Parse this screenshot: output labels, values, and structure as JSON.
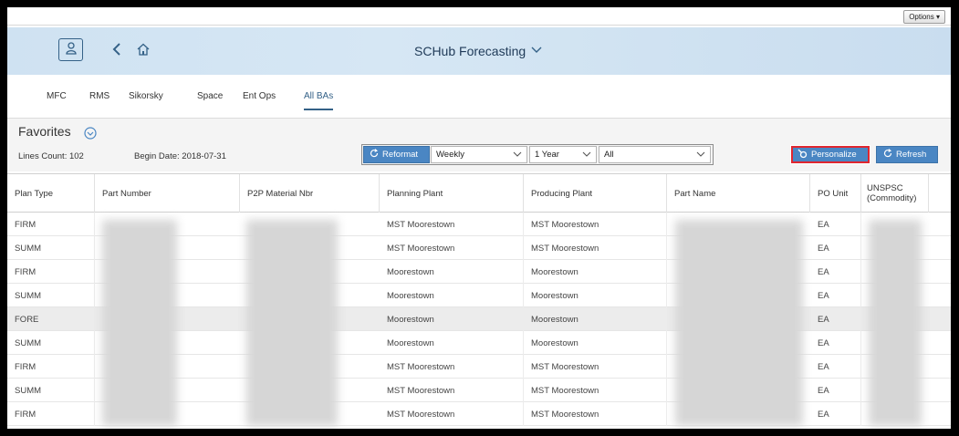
{
  "options": {
    "label": "Options ▾"
  },
  "shell": {
    "title": "SCHub Forecasting",
    "icons": {
      "user": "user-icon",
      "back": "back-chevron-icon",
      "home": "home-icon",
      "title_menu": "chevron-down-icon"
    }
  },
  "tabs": [
    {
      "label": "MFC",
      "active": false
    },
    {
      "label": "RMS",
      "active": false
    },
    {
      "label": "Sikorsky",
      "active": false
    },
    {
      "label": "Space",
      "active": false
    },
    {
      "label": "Ent Ops",
      "active": false
    },
    {
      "label": "All BAs",
      "active": true
    }
  ],
  "filters": {
    "favorites_label": "Favorites",
    "lines_count": "Lines Count: 102",
    "begin_date": "Begin Date: 2018-07-31",
    "reformat_label": "Reformat",
    "period_value": "Weekly",
    "range_value": "1 Year",
    "scope_value": "All",
    "personalize_label": "Personalize",
    "refresh_label": "Refresh"
  },
  "table": {
    "columns": [
      "Plan Type",
      "Part Number",
      "P2P Material Nbr",
      "Planning Plant",
      "Producing Plant",
      "Part Name",
      "PO Unit",
      "UNSPSC (Commodity)"
    ],
    "rows": [
      {
        "plan_type": "FIRM",
        "planning_plant": "MST Moorestown",
        "producing_plant": "MST Moorestown",
        "po_unit": "EA",
        "highlight": false
      },
      {
        "plan_type": "SUMM",
        "planning_plant": "MST Moorestown",
        "producing_plant": "MST Moorestown",
        "po_unit": "EA",
        "highlight": false
      },
      {
        "plan_type": "FIRM",
        "planning_plant": "Moorestown",
        "producing_plant": "Moorestown",
        "po_unit": "EA",
        "highlight": false
      },
      {
        "plan_type": "SUMM",
        "planning_plant": "Moorestown",
        "producing_plant": "Moorestown",
        "po_unit": "EA",
        "highlight": false
      },
      {
        "plan_type": "FORE",
        "planning_plant": "Moorestown",
        "producing_plant": "Moorestown",
        "po_unit": "EA",
        "highlight": true
      },
      {
        "plan_type": "SUMM",
        "planning_plant": "Moorestown",
        "producing_plant": "Moorestown",
        "po_unit": "EA",
        "highlight": false
      },
      {
        "plan_type": "FIRM",
        "planning_plant": "MST Moorestown",
        "producing_plant": "MST Moorestown",
        "po_unit": "EA",
        "highlight": false
      },
      {
        "plan_type": "SUMM",
        "planning_plant": "MST Moorestown",
        "producing_plant": "MST Moorestown",
        "po_unit": "EA",
        "highlight": false
      },
      {
        "plan_type": "FIRM",
        "planning_plant": "MST Moorestown",
        "producing_plant": "MST Moorestown",
        "po_unit": "EA",
        "highlight": false
      }
    ]
  },
  "colors": {
    "shell_bg": "#cfe2f2",
    "accent": "#4a86c3",
    "active_tab": "#346187",
    "personalize_outline": "#e0262f",
    "row_highlight": "#ececec"
  }
}
